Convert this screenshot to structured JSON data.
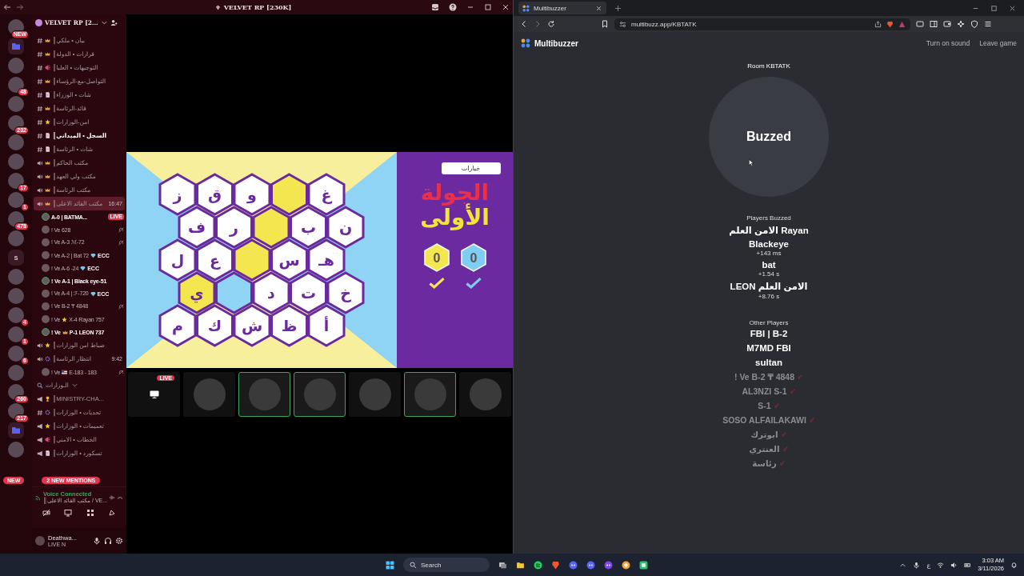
{
  "discord": {
    "title": "VELVET RP [230K]",
    "server_name": "VELVET RP [2...",
    "servers": [
      {
        "kind": "avatar",
        "badge": "NEW"
      },
      {
        "kind": "folder"
      },
      {
        "kind": "avatar"
      },
      {
        "kind": "avatar",
        "badge": "48"
      },
      {
        "kind": "avatar"
      },
      {
        "kind": "avatar",
        "badge": "232"
      },
      {
        "kind": "avatar"
      },
      {
        "kind": "avatar"
      },
      {
        "kind": "avatar",
        "badge": "17"
      },
      {
        "kind": "avatar",
        "badge": "1"
      },
      {
        "kind": "avatar",
        "badge": "478"
      },
      {
        "kind": "avatar"
      },
      {
        "kind": "letter",
        "label": "S"
      },
      {
        "kind": "avatar"
      },
      {
        "kind": "avatar"
      },
      {
        "kind": "avatar",
        "badge": "4"
      },
      {
        "kind": "avatar",
        "badge": "1"
      },
      {
        "kind": "avatar",
        "badge": "6"
      },
      {
        "kind": "avatar"
      },
      {
        "kind": "avatar",
        "badge": "260"
      },
      {
        "kind": "avatar",
        "badge": "217"
      },
      {
        "kind": "folder"
      },
      {
        "kind": "avatar"
      }
    ],
    "channels": [
      {
        "kind": "text",
        "emoji": {
          "kind": "crown"
        },
        "name": "║بيان • ملكي",
        "selected": false,
        "unread": false
      },
      {
        "kind": "text",
        "emoji": {
          "kind": "crown"
        },
        "name": "║قرارات • الدولة",
        "selected": false,
        "unread": false
      },
      {
        "kind": "text",
        "emoji": {
          "kind": "megaphone"
        },
        "name": "║التوجيهات • العليا",
        "selected": false,
        "unread": false
      },
      {
        "kind": "text",
        "emoji": {
          "kind": "crown"
        },
        "name": "║التواصل-مع-الرؤساء",
        "selected": false,
        "unread": false
      },
      {
        "kind": "text",
        "emoji": {
          "kind": "page"
        },
        "name": "║شات • الوزراء",
        "selected": false,
        "unread": false
      },
      {
        "kind": "text",
        "emoji": {
          "kind": "crown"
        },
        "name": "║قائد-الرئاسة",
        "selected": false,
        "unread": false
      },
      {
        "kind": "text",
        "emoji": {
          "kind": "star"
        },
        "name": "║امن-الوزارات",
        "selected": false,
        "unread": false
      },
      {
        "kind": "text",
        "emoji": {
          "kind": "page"
        },
        "name": "║السجل • الميداني",
        "selected": false,
        "unread": true
      },
      {
        "kind": "text",
        "emoji": {
          "kind": "page"
        },
        "name": "║شات • الرئاسة",
        "selected": false,
        "unread": false
      },
      {
        "kind": "voice",
        "emoji": {
          "kind": "crown"
        },
        "name": "║مكتب الحاكم",
        "selected": false,
        "unread": false
      },
      {
        "kind": "voice",
        "emoji": {
          "kind": "crown"
        },
        "name": "║مكتب ولي العهد",
        "selected": false,
        "unread": false
      },
      {
        "kind": "voice",
        "emoji": {
          "kind": "crown"
        },
        "name": "║مكتب الرئاسة",
        "selected": false,
        "unread": false
      },
      {
        "kind": "voice",
        "emoji": {
          "kind": "crown"
        },
        "name": "║مكتب القائد الاعلى",
        "time": "16:47",
        "selected": true,
        "unread": false,
        "members": [
          {
            "name": "A-0 | BATMA...",
            "speaking": true,
            "live": "LIVE",
            "deafened": false
          },
          {
            "name": "! Ve 628",
            "speaking": false,
            "deafened": true
          },
          {
            "name": "! Ve A-3 ℳ-72",
            "speaking": false,
            "deafened": true
          },
          {
            "name": "! Ve A-2 | Bat 72",
            "speaking": false,
            "deafened": false,
            "tag": "ECC"
          },
          {
            "name": "! Ve A-6 -24",
            "speaking": false,
            "deafened": false,
            "tag": "ECC"
          },
          {
            "name": "! Ve A-1 | Black eye-51",
            "speaking": true,
            "deafened": false
          },
          {
            "name": "! Ve A-4 | ℱ-720",
            "speaking": false,
            "deafened": false,
            "tag": "ECC"
          },
          {
            "name": "! Ve B-2 ₸ 4848",
            "speaking": false,
            "deafened": true
          },
          {
            "prefix": "! Ve",
            "emoji": {
              "kind": "star"
            },
            "name": "X-4 Rayan 757",
            "speaking": false,
            "deafened": false
          },
          {
            "prefix": "! Ve",
            "emoji": {
              "kind": "crown"
            },
            "name": "P-1 LEON 737",
            "speaking": true,
            "deafened": false
          }
        ]
      },
      {
        "kind": "voice",
        "emoji": {
          "kind": "star"
        },
        "name": "║ضباط امن الوزارات",
        "selected": false,
        "unread": false
      },
      {
        "kind": "voice",
        "emoji": {
          "kind": "gear"
        },
        "name": "║انتظار الرئاسة",
        "time": "9:42",
        "selected": false,
        "unread": false,
        "members": [
          {
            "prefix": "! Ve",
            "emoji": {
              "kind": "flag"
            },
            "name": "E-183 - 183",
            "speaking": false,
            "deafened": true
          }
        ]
      },
      {
        "kind": "category",
        "name": "الـوزارات"
      },
      {
        "kind": "announcement",
        "emoji": {
          "kind": "trophy"
        },
        "name": "║MINISTRY-CHA...",
        "selected": false,
        "unread": false
      },
      {
        "kind": "text",
        "emoji": {
          "kind": "gear"
        },
        "name": "║تحديات • الوزارات",
        "selected": false,
        "unread": false
      },
      {
        "kind": "announcement",
        "emoji": {
          "kind": "star"
        },
        "name": "║تعميمات • الوزارات",
        "selected": false,
        "unread": false
      },
      {
        "kind": "announcement",
        "emoji": {
          "kind": "megaphone"
        },
        "name": "║الخطاب • الامني",
        "selected": false,
        "unread": false
      },
      {
        "kind": "announcement",
        "emoji": {
          "kind": "page"
        },
        "name": "║تسكورد • الوزارات",
        "selected": false,
        "unread": false
      }
    ],
    "new_badge": "NEW",
    "mentions": "2 NEW MENTIONS",
    "voice": {
      "status": "Voice Connected",
      "channel": "║مكتب القائد الاعلى / VE..."
    },
    "user": {
      "name": "Deathwa...",
      "status": "LIVE N"
    },
    "game": {
      "options_button": "خيارات",
      "round_title": [
        "الجولة",
        "الأولى"
      ],
      "scores": [
        {
          "score": "0",
          "color": "#7fcdf3"
        },
        {
          "score": "0",
          "color": "#f3e64f"
        }
      ],
      "rows": [
        [
          {
            "letter": "غ",
            "color": "#ffffff"
          },
          {
            "color": "#f3e64f"
          },
          {
            "letter": "و",
            "color": "#ffffff"
          },
          {
            "letter": "ق",
            "color": "#ffffff"
          },
          {
            "letter": "ز",
            "color": "#ffffff"
          }
        ],
        [
          {
            "letter": "ن",
            "color": "#ffffff"
          },
          {
            "letter": "ب",
            "color": "#ffffff"
          },
          {
            "color": "#f3e64f"
          },
          {
            "letter": "ر",
            "color": "#ffffff"
          },
          {
            "letter": "ف",
            "color": "#ffffff"
          }
        ],
        [
          {
            "letter": "هـ",
            "color": "#ffffff"
          },
          {
            "letter": "س",
            "color": "#ffffff"
          },
          {
            "color": "#f3e64f"
          },
          {
            "letter": "ع",
            "color": "#ffffff"
          },
          {
            "letter": "ل",
            "color": "#ffffff"
          }
        ],
        [
          {
            "letter": "خ",
            "color": "#ffffff"
          },
          {
            "letter": "ت",
            "color": "#ffffff"
          },
          {
            "letter": "د",
            "color": "#ffffff"
          },
          {
            "color": "#8fd3f5"
          },
          {
            "letter": "ي",
            "color": "#f3e64f"
          }
        ],
        [
          {
            "letter": "أ",
            "color": "#ffffff"
          },
          {
            "letter": "ظ",
            "color": "#ffffff"
          },
          {
            "letter": "ش",
            "color": "#ffffff"
          },
          {
            "letter": "ك",
            "color": "#ffffff"
          },
          {
            "letter": "م",
            "color": "#ffffff"
          }
        ]
      ]
    },
    "tiles": [
      {
        "kind": "screen",
        "live": "LIVE",
        "speaking": false
      },
      {
        "kind": "avatar",
        "speaking": false
      },
      {
        "kind": "avatar",
        "speaking": true
      },
      {
        "kind": "avatar",
        "speaking": true
      },
      {
        "kind": "avatar",
        "speaking": false
      },
      {
        "kind": "avatar",
        "speaking": true
      },
      {
        "kind": "avatar",
        "speaking": false
      }
    ]
  },
  "browser": {
    "tab": "Multibuzzer",
    "url": "multibuzz.app/KBTATK",
    "brand": "Multibuzzer",
    "sound_link": "Turn on sound",
    "leave_link": "Leave game",
    "room": "Room KBTATK",
    "buzzer": "Buzzed",
    "buzzed_heading": "Players Buzzed",
    "buzzed": [
      {
        "name": "الامن العلم Rayan"
      },
      {
        "name": "Blackeye",
        "delay": "+143 ms"
      },
      {
        "name": "bat",
        "delay": "+1.54 s"
      },
      {
        "name": "LEON الامن العلم",
        "delay": "+8.76 s"
      }
    ],
    "others_heading": "Other Players",
    "others": [
      {
        "name": "FBI | B-2",
        "connected": true
      },
      {
        "name": "M7MD FBI",
        "connected": true
      },
      {
        "name": "sultan",
        "connected": true
      },
      {
        "name": "! Ve B-2 ₸ 4848",
        "connected": false
      },
      {
        "name": "AL3NZI S-1",
        "connected": false
      },
      {
        "name": "S-1",
        "connected": false
      },
      {
        "name": "SOSO ALFAILAKAWI",
        "connected": false
      },
      {
        "name": "ابوترك",
        "connected": false
      },
      {
        "name": "العنتري",
        "connected": false
      },
      {
        "name": "رئاسة",
        "connected": false
      }
    ]
  },
  "taskbar": {
    "search": "Search",
    "lang": "ع",
    "time": "3:03 AM",
    "date": "3/11/2026"
  }
}
